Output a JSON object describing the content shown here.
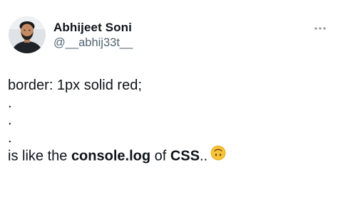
{
  "author": {
    "display_name": "Abhijeet Soni",
    "handle": "@__abhij33t__",
    "avatar_icon": "profile-photo"
  },
  "menu": {
    "icon": "more-horizontal-icon"
  },
  "tweet": {
    "line1": "border: 1px solid red;",
    "dot1": ".",
    "dot2": ".",
    "dot3": ".",
    "last_prefix": "is like the ",
    "last_bold1": "console.log",
    "last_mid": " of ",
    "last_bold2": "CSS",
    "last_suffix": "..",
    "emoji": "upside-down-face-emoji"
  },
  "colors": {
    "text": "#0f1419",
    "secondary": "#536471",
    "emoji": "#f6c33a"
  }
}
